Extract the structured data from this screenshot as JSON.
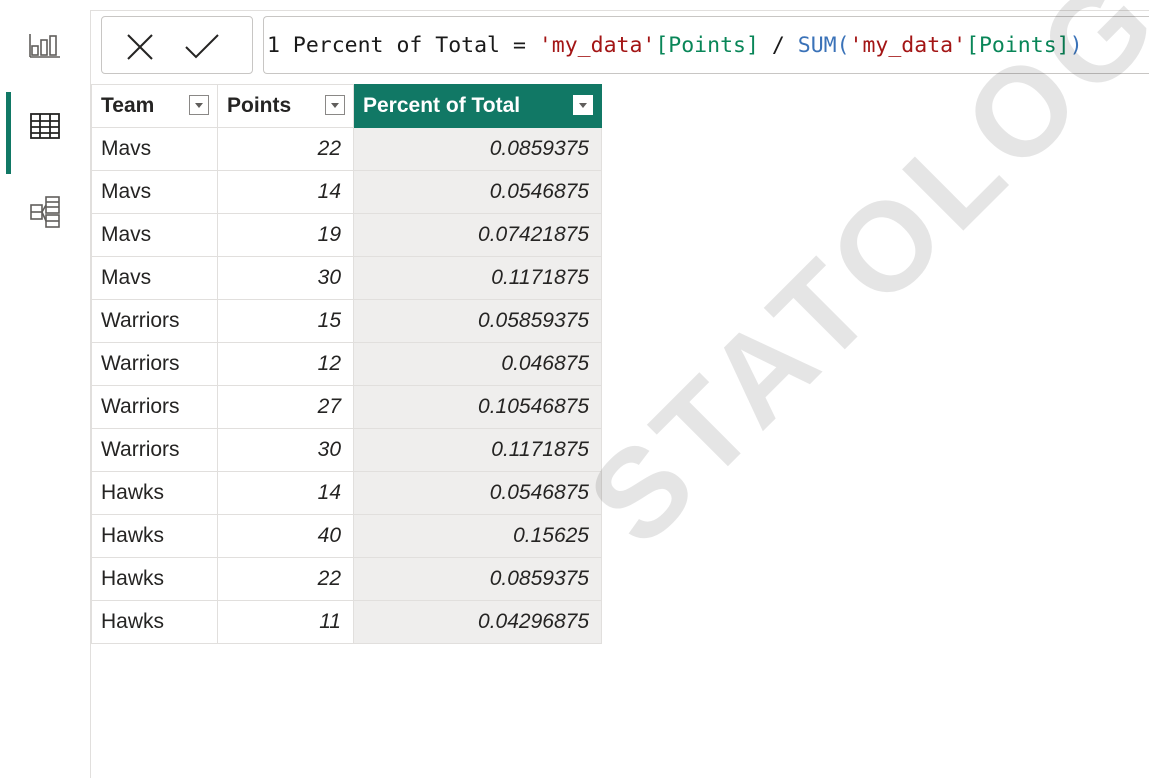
{
  "rail": {
    "items": [
      {
        "name": "report-view",
        "icon": "bar-chart-icon"
      },
      {
        "name": "table-view",
        "icon": "table-grid-icon",
        "active": true
      },
      {
        "name": "model-view",
        "icon": "model-diagram-icon"
      }
    ]
  },
  "formula_bar": {
    "cancel_icon": "close-icon",
    "commit_icon": "checkmark-icon",
    "line_number": "1",
    "tokens": {
      "measure_name": " Percent of Total = ",
      "table_ref_1": "'my_data'",
      "column_ref_1": "[Points]",
      "operator": " / ",
      "function": "SUM(",
      "table_ref_2": "'my_data'",
      "column_ref_2": "[Points]",
      "close_paren": ")"
    }
  },
  "table": {
    "columns": [
      "Team",
      "Points",
      "Percent of Total"
    ],
    "selected_column": "Percent of Total",
    "rows": [
      {
        "team": "Mavs",
        "points": "22",
        "pct": "0.0859375"
      },
      {
        "team": "Mavs",
        "points": "14",
        "pct": "0.0546875"
      },
      {
        "team": "Mavs",
        "points": "19",
        "pct": "0.07421875"
      },
      {
        "team": "Mavs",
        "points": "30",
        "pct": "0.1171875"
      },
      {
        "team": "Warriors",
        "points": "15",
        "pct": "0.05859375"
      },
      {
        "team": "Warriors",
        "points": "12",
        "pct": "0.046875"
      },
      {
        "team": "Warriors",
        "points": "27",
        "pct": "0.10546875"
      },
      {
        "team": "Warriors",
        "points": "30",
        "pct": "0.1171875"
      },
      {
        "team": "Hawks",
        "points": "14",
        "pct": "0.0546875"
      },
      {
        "team": "Hawks",
        "points": "40",
        "pct": "0.15625"
      },
      {
        "team": "Hawks",
        "points": "22",
        "pct": "0.0859375"
      },
      {
        "team": "Hawks",
        "points": "11",
        "pct": "0.04296875"
      }
    ]
  },
  "watermark": "STATOLOGY.COM",
  "colors": {
    "accent": "#117865",
    "string_token": "#a31515",
    "column_token": "#098658",
    "function_token": "#3a72b8"
  }
}
